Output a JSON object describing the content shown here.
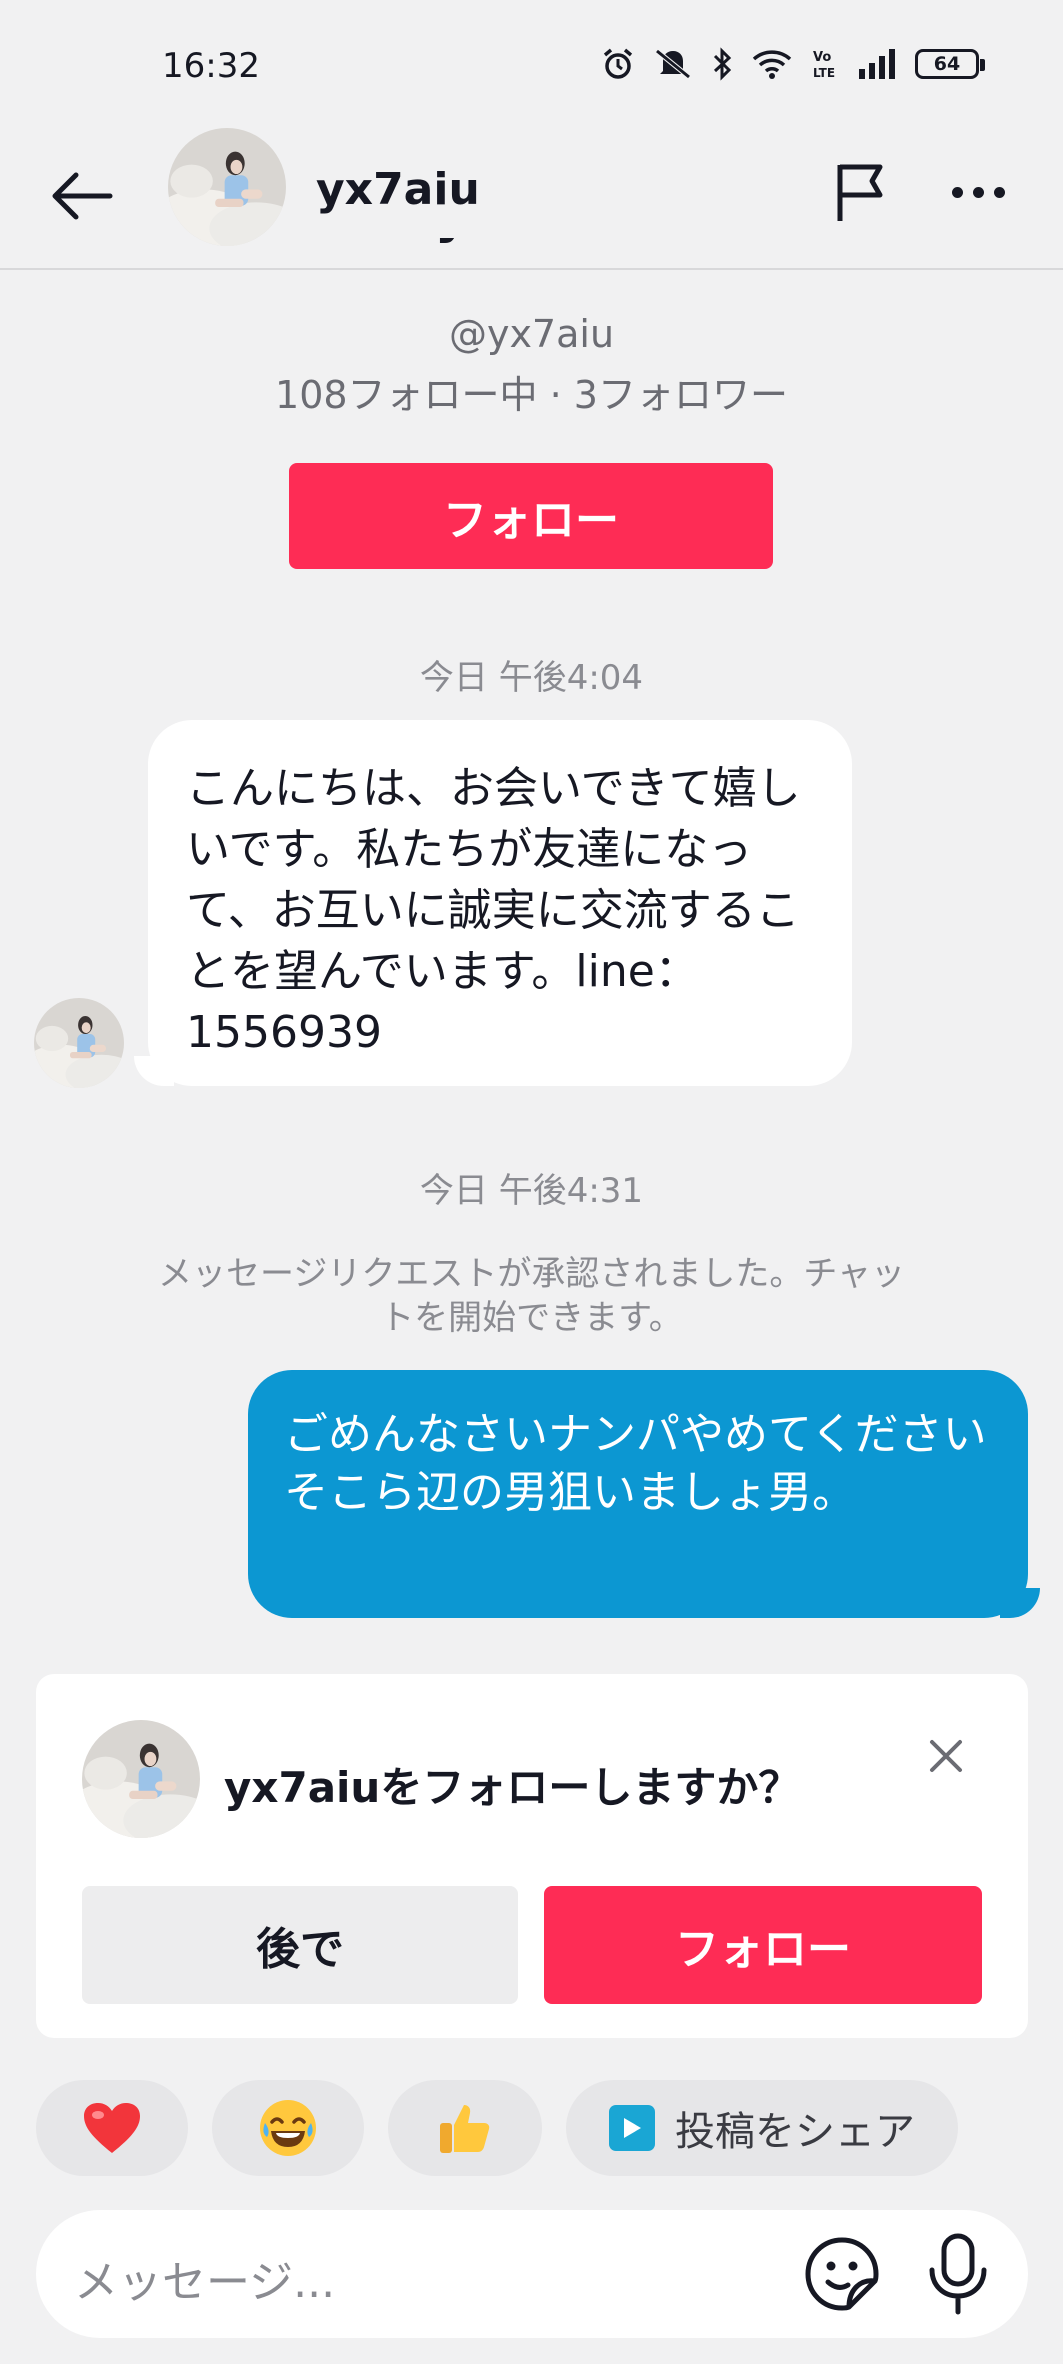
{
  "status_bar": {
    "time": "16:32",
    "battery": "64"
  },
  "header": {
    "username": "yx7aiu"
  },
  "profile": {
    "display_name": "yx7aiu",
    "handle": "@yx7aiu",
    "stats": "108フォロー中 · 3フォロワー",
    "follow_label": "フォロー"
  },
  "messages": {
    "timestamp_1": "今日 午後4:04",
    "incoming_text": "こんにちは、お会いできて嬉しいです。私たちが友達になって、お互いに誠実に交流することを望んでいます。line：1556939",
    "timestamp_2": "今日 午後4:31",
    "system_note": "メッセージリクエストが承認されました。チャットを開始できます。",
    "outgoing_line1": "ごめんなさいナンパやめてください",
    "outgoing_line2": "そこら辺の男狙いましょ男。"
  },
  "follow_card": {
    "question": "yx7aiuをフォローしますか？",
    "later_label": "後で",
    "follow_label": "フォロー"
  },
  "quick_replies": {
    "heart": "❤️",
    "laugh": "😂",
    "thumbs": "👍",
    "share_label": "投稿をシェア"
  },
  "composer": {
    "placeholder": "メッセージ..."
  }
}
